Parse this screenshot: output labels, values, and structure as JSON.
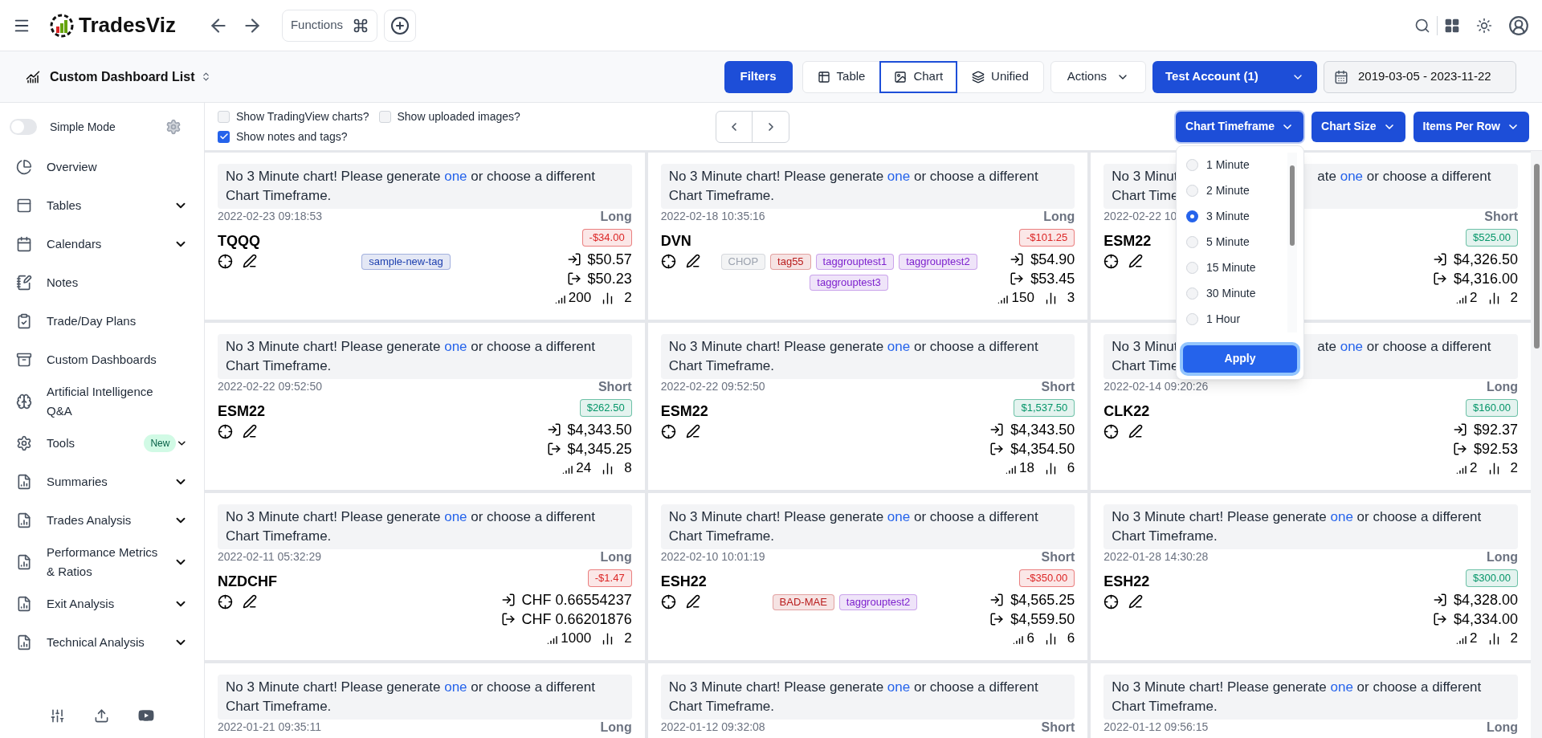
{
  "header": {
    "brand": "TradesViz",
    "functions_label": "Functions"
  },
  "toolbar": {
    "dashboard_title": "Custom Dashboard List",
    "filters_label": "Filters",
    "views": [
      {
        "label": "Table",
        "selected": false
      },
      {
        "label": "Chart",
        "selected": true
      },
      {
        "label": "Unified",
        "selected": false
      }
    ],
    "actions_label": "Actions",
    "account_label": "Test Account (1)",
    "date_range": "2019-03-05 - 2023-11-22"
  },
  "sidebar": {
    "simple_mode": {
      "label": "Simple Mode",
      "on": false
    },
    "items": [
      {
        "label": "Overview",
        "has_submenu": false
      },
      {
        "label": "Tables",
        "has_submenu": true
      },
      {
        "label": "Calendars",
        "has_submenu": true
      },
      {
        "label": "Notes",
        "has_submenu": false
      },
      {
        "label": "Trade/Day Plans",
        "has_submenu": false
      },
      {
        "label": "Custom Dashboards",
        "has_submenu": false
      },
      {
        "label": "Artificial Intelligence Q&A",
        "has_submenu": false
      },
      {
        "label": "Tools",
        "has_submenu": true,
        "badge": "New"
      },
      {
        "label": "Summaries",
        "has_submenu": true
      },
      {
        "label": "Trades Analysis",
        "has_submenu": true
      },
      {
        "label": "Performance Metrics & Ratios",
        "has_submenu": true
      },
      {
        "label": "Exit Analysis",
        "has_submenu": true
      },
      {
        "label": "Technical Analysis",
        "has_submenu": true
      }
    ]
  },
  "options": {
    "checkboxes": [
      {
        "label": "Show TradingView charts?",
        "checked": false
      },
      {
        "label": "Show uploaded images?",
        "checked": false
      },
      {
        "label": "Show notes and tags?",
        "checked": true
      }
    ],
    "dropdowns": [
      {
        "label": "Chart Timeframe",
        "expanded": true
      },
      {
        "label": "Chart Size",
        "expanded": false
      },
      {
        "label": "Items Per Row",
        "expanded": false
      }
    ]
  },
  "timeframe_menu": {
    "options": [
      {
        "label": "1 Minute",
        "selected": false
      },
      {
        "label": "2 Minute",
        "selected": false
      },
      {
        "label": "3 Minute",
        "selected": true
      },
      {
        "label": "5 Minute",
        "selected": false
      },
      {
        "label": "15 Minute",
        "selected": false
      },
      {
        "label": "30 Minute",
        "selected": false
      },
      {
        "label": "1 Hour",
        "selected": false
      }
    ],
    "apply_label": "Apply"
  },
  "cards": [
    {
      "notice": {
        "kind": "full",
        "before": "No 3 Minute chart! Please generate",
        "link": "one",
        "after": "or choose a different Chart Timeframe."
      },
      "date": "2022-02-23 09:18:53",
      "side": "Long",
      "ticker": "TQQQ",
      "pnl": {
        "text": "-$34.00",
        "color": "#dc2626"
      },
      "tags": [
        {
          "label": "sample-new-tag",
          "color": "#1e40af"
        }
      ],
      "entry": "$50.57",
      "exit": "$50.23",
      "quantity": "200",
      "executions": "2"
    },
    {
      "notice": {
        "kind": "full",
        "before": "No 3 Minute chart! Please generate",
        "link": "one",
        "after": "or choose a different Chart Timeframe."
      },
      "date": "2022-02-18 10:35:16",
      "side": "Long",
      "ticker": "DVN",
      "pnl": {
        "text": "-$101.25",
        "color": "#dc2626"
      },
      "tags": [
        {
          "label": "CHOP",
          "color": "#9ca3af"
        },
        {
          "label": "tag55",
          "color": "#b91c1c"
        },
        {
          "label": "taggrouptest1",
          "color": "#7e22ce"
        },
        {
          "label": "taggrouptest2",
          "color": "#7e22ce"
        },
        {
          "label": "taggrouptest3",
          "color": "#7e22ce"
        }
      ],
      "entry": "$54.90",
      "exit": "$53.45",
      "quantity": "150",
      "executions": "3"
    },
    {
      "notice": {
        "kind": "covered",
        "lead": "No 3 Minut",
        "before": "ate",
        "link": "one",
        "after": "or choose a different",
        "tail": "Chart Time"
      },
      "date": "2022-02-22 10",
      "side": "Short",
      "ticker": "ESM22",
      "pnl": {
        "text": "$525.00",
        "color": "#059669"
      },
      "entry": "$4,326.50",
      "exit": "$4,316.00",
      "quantity": "2",
      "executions": "2"
    },
    {
      "notice": {
        "kind": "full",
        "before": "No 3 Minute chart! Please generate",
        "link": "one",
        "after": "or choose a different Chart Timeframe."
      },
      "date": "2022-02-22 09:52:50",
      "side": "Short",
      "ticker": "ESM22",
      "pnl": {
        "text": "$262.50",
        "color": "#059669"
      },
      "entry": "$4,343.50",
      "exit": "$4,345.25",
      "quantity": "24",
      "executions": "8"
    },
    {
      "notice": {
        "kind": "full",
        "before": "No 3 Minute chart! Please generate",
        "link": "one",
        "after": "or choose a different Chart Timeframe."
      },
      "date": "2022-02-22 09:52:50",
      "side": "Short",
      "ticker": "ESM22",
      "pnl": {
        "text": "$1,537.50",
        "color": "#059669"
      },
      "entry": "$4,343.50",
      "exit": "$4,354.50",
      "quantity": "18",
      "executions": "6"
    },
    {
      "notice": {
        "kind": "covered",
        "lead": "No 3 Minut",
        "before": "ate",
        "link": "one",
        "after": "or choose a different",
        "tail": "Chart Time"
      },
      "date": "2022-02-14 09:20:26",
      "side": "Long",
      "ticker": "CLK22",
      "pnl": {
        "text": "$160.00",
        "color": "#059669"
      },
      "entry": "$92.37",
      "exit": "$92.53",
      "quantity": "2",
      "executions": "2"
    },
    {
      "notice": {
        "kind": "full",
        "before": "No 3 Minute chart! Please generate",
        "link": "one",
        "after": "or choose a different Chart Timeframe."
      },
      "date": "2022-02-11 05:32:29",
      "side": "Long",
      "ticker": "NZDCHF",
      "pnl": {
        "text": "-$1.47",
        "color": "#dc2626"
      },
      "entry": "CHF 0.66554237",
      "exit": "CHF 0.66201876",
      "quantity": "1000",
      "executions": "2"
    },
    {
      "notice": {
        "kind": "full",
        "before": "No 3 Minute chart! Please generate",
        "link": "one",
        "after": "or choose a different Chart Timeframe."
      },
      "date": "2022-02-10 10:01:19",
      "side": "Short",
      "ticker": "ESH22",
      "pnl": {
        "text": "-$350.00",
        "color": "#dc2626"
      },
      "tags": [
        {
          "label": "BAD-MAE",
          "color": "#b91c1c"
        },
        {
          "label": "taggrouptest2",
          "color": "#7e22ce"
        }
      ],
      "entry": "$4,565.25",
      "exit": "$4,559.50",
      "quantity": "6",
      "executions": "6"
    },
    {
      "notice": {
        "kind": "full",
        "before": "No 3 Minute chart! Please generate",
        "link": "one",
        "after": "or choose a different Chart Timeframe."
      },
      "date": "2022-01-28 14:30:28",
      "side": "Long",
      "ticker": "ESH22",
      "pnl": {
        "text": "$300.00",
        "color": "#059669"
      },
      "entry": "$4,328.00",
      "exit": "$4,334.00",
      "quantity": "2",
      "executions": "2"
    },
    {
      "notice": {
        "kind": "full",
        "before": "No 3 Minute chart! Please generate",
        "link": "one",
        "after": "or choose a different Chart Timeframe."
      },
      "date": "2022-01-21 09:35:11",
      "side": "Long"
    },
    {
      "notice": {
        "kind": "full",
        "before": "No 3 Minute chart! Please generate",
        "link": "one",
        "after": "or choose a different Chart Timeframe."
      },
      "date": "2022-01-12 09:32:08",
      "side": "Short"
    },
    {
      "notice": {
        "kind": "full",
        "before": "No 3 Minute chart! Please generate",
        "link": "one",
        "after": "or choose a different Chart Timeframe."
      },
      "date": "2022-01-12 09:56:15",
      "side": "Long"
    }
  ]
}
